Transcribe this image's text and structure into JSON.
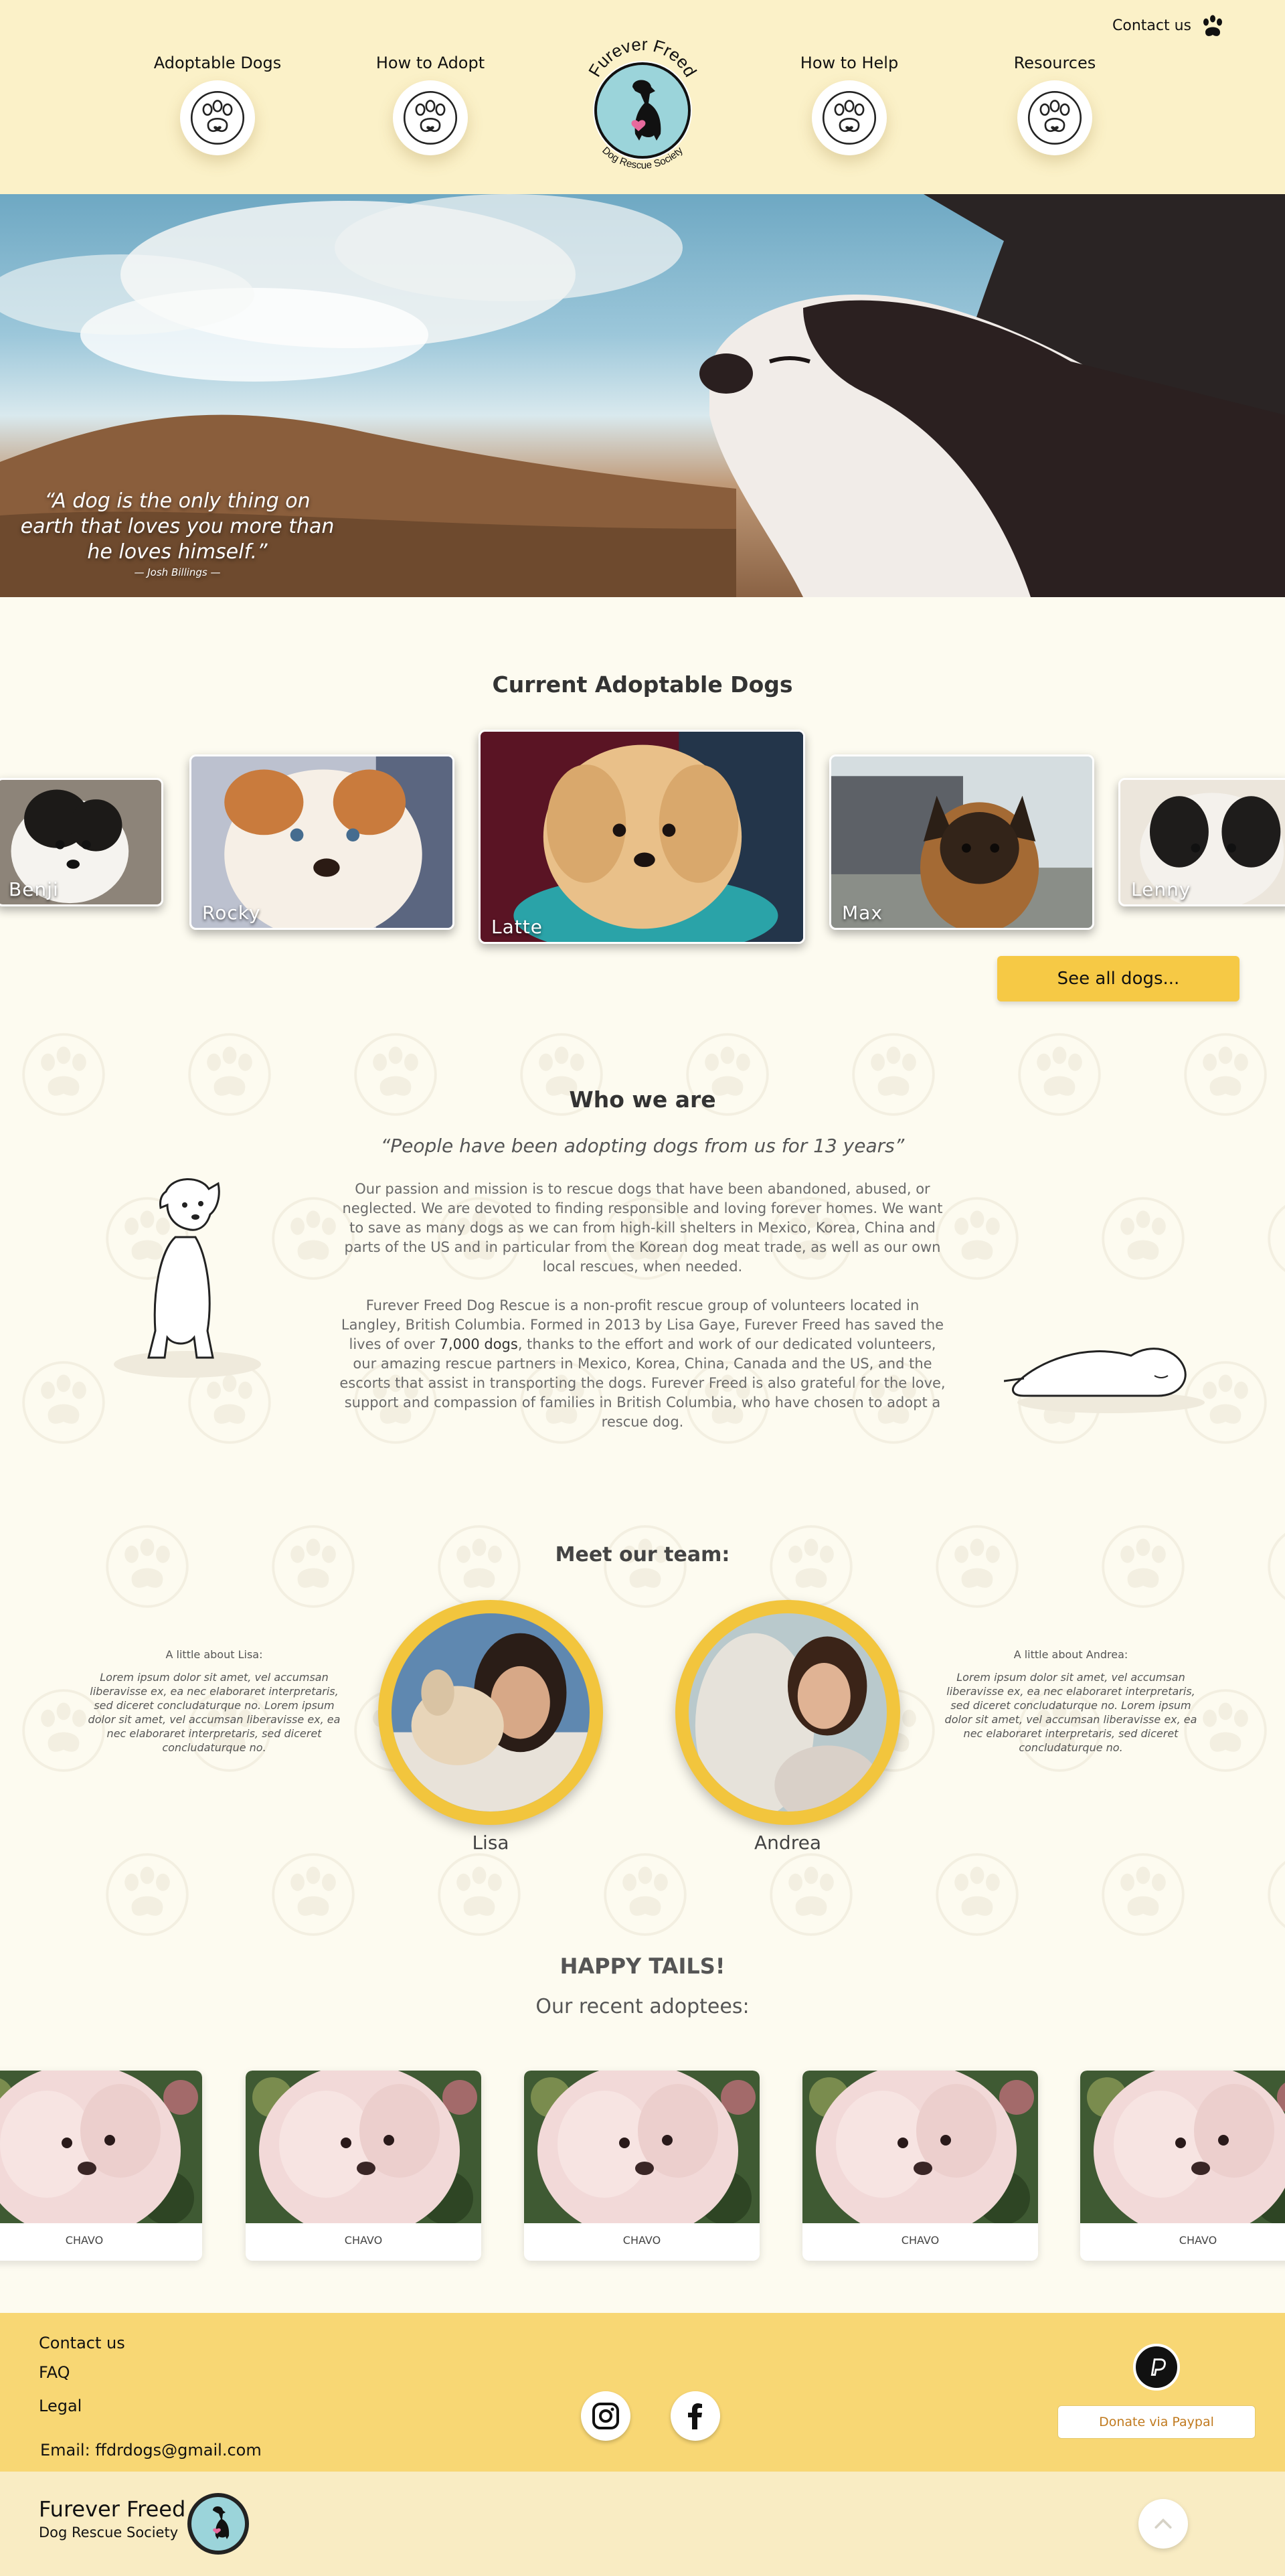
{
  "header": {
    "contact_label": "Contact us",
    "nav": [
      {
        "label": "Adoptable Dogs"
      },
      {
        "label": "How to Adopt"
      },
      {
        "label": "How to Help"
      },
      {
        "label": "Resources"
      }
    ],
    "logo": {
      "top_text": "Furever Freed",
      "bottom_text": "Dog Rescue Society"
    }
  },
  "hero": {
    "quote": "“A dog is the only thing on earth that loves you more than he loves himself.”",
    "author": "— Josh Billings —"
  },
  "dogs": {
    "title": "Current Adoptable Dogs",
    "items": [
      {
        "name": "Benji"
      },
      {
        "name": "Rocky"
      },
      {
        "name": "Latte"
      },
      {
        "name": "Max"
      },
      {
        "name": "Lenny"
      }
    ],
    "see_all_label": "See all dogs..."
  },
  "about": {
    "title": "Who we are",
    "quote": "“People have been adopting dogs from us for 13 years”",
    "p1": "Our passion and mission is to rescue dogs that have been abandoned, abused, or neglected.  We are devoted to finding responsible and loving forever homes.  We want to save as many dogs as we can from high-kill shelters in Mexico, Korea, China and parts of the US and in particular from the Korean dog meat trade, as well as our own local rescues, when needed.",
    "p2_before": "Furever Freed Dog Rescue is a non-profit rescue group of volunteers located in Langley, British Columbia. Formed in 2013 by Lisa Gaye, Furever Freed has saved the lives of over ",
    "p2_highlight": "7,000 dogs",
    "p2_after": ", thanks to the effort and work of our dedicated volunteers, our amazing rescue partners in Mexico, Korea, China, Canada and the US, and the escorts that assist in transporting the dogs. Furever Freed is also grateful for the love, support and compassion of families in British Columbia, who have chosen to adopt a rescue dog."
  },
  "team": {
    "title": "Meet our team:",
    "members": [
      {
        "name": "Lisa",
        "blurb_title": "A little about Lisa:",
        "blurb": "Lorem ipsum dolor sit amet, vel accumsan liberavisse ex, ea nec elaboraret interpretaris, sed diceret concludaturque no. Lorem ipsum dolor sit amet, vel accumsan liberavisse ex, ea nec elaboraret interpretaris, sed diceret concludaturque no."
      },
      {
        "name": "Andrea",
        "blurb_title": "A little about Andrea:",
        "blurb": "Lorem ipsum dolor sit amet, vel accumsan liberavisse ex, ea nec elaboraret interpretaris, sed diceret concludaturque no. Lorem ipsum dolor sit amet, vel accumsan liberavisse ex, ea nec elaboraret interpretaris, sed diceret concludaturque no."
      }
    ]
  },
  "adoptees": {
    "title": "HAPPY TAILS!",
    "subtitle": "Our recent adoptees:",
    "items": [
      {
        "name": "CHAVO"
      },
      {
        "name": "CHAVO"
      },
      {
        "name": "CHAVO"
      },
      {
        "name": "CHAVO"
      },
      {
        "name": "CHAVO"
      }
    ]
  },
  "footer": {
    "links": [
      "Contact us",
      "FAQ",
      "Legal"
    ],
    "email": "Email: ffdrdogs@gmail.com",
    "donate_label": "Donate via Paypal",
    "brand_name": "Furever Freed",
    "brand_sub": "Dog Rescue Society",
    "social": [
      "instagram-icon",
      "facebook-icon"
    ]
  },
  "colors": {
    "header_bg": "#fbf1c8",
    "accent": "#f6c945",
    "footer_bg": "#f8d774",
    "page_bg": "#fdfbf0"
  }
}
